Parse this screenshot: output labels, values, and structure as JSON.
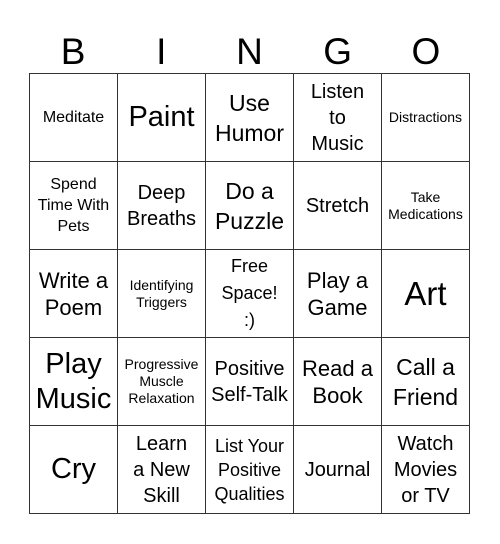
{
  "header": {
    "letters": [
      "B",
      "I",
      "N",
      "G",
      "O"
    ]
  },
  "card": {
    "rows": [
      [
        "Meditate",
        "Paint",
        "Use Humor",
        "Listen to Music",
        "Distractions"
      ],
      [
        "Spend Time With Pets",
        "Deep Breaths",
        "Do a Puzzle",
        "Stretch",
        "Take Medications"
      ],
      [
        "Write a Poem",
        "Identifying Triggers",
        "Free Space! :)",
        "Play a Game",
        "Art"
      ],
      [
        "Play Music",
        "Progressive Muscle Relaxation",
        "Positive Self-Talk",
        "Read a Book",
        "Call a Friend"
      ],
      [
        "Cry",
        "Learn a New Skill",
        "List Your Positive Qualities",
        "Journal",
        "Watch Movies or TV"
      ]
    ]
  }
}
